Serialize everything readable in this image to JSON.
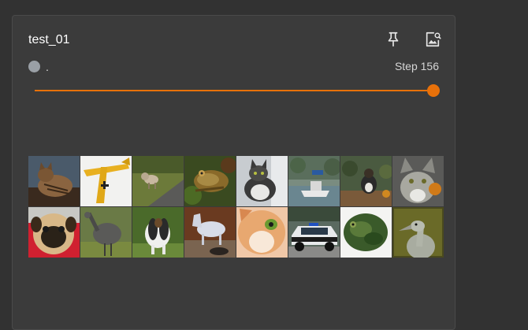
{
  "card": {
    "title": "test_01",
    "run_label": ".",
    "run_color": "#9aa0a6",
    "step_label": "Step 156",
    "slider": {
      "value_fraction": 1.0,
      "color": "#e8710a"
    },
    "icons": [
      "pin-icon",
      "image-expand-icon"
    ]
  },
  "images": [
    {
      "subject": "cat"
    },
    {
      "subject": "airplane"
    },
    {
      "subject": "dog"
    },
    {
      "subject": "frog"
    },
    {
      "subject": "cat"
    },
    {
      "subject": "ship"
    },
    {
      "subject": "dog"
    },
    {
      "subject": "cat"
    },
    {
      "subject": "dog"
    },
    {
      "subject": "bird"
    },
    {
      "subject": "dog"
    },
    {
      "subject": "horse"
    },
    {
      "subject": "cat"
    },
    {
      "subject": "automobile"
    },
    {
      "subject": "frog"
    },
    {
      "subject": "bird"
    }
  ]
}
